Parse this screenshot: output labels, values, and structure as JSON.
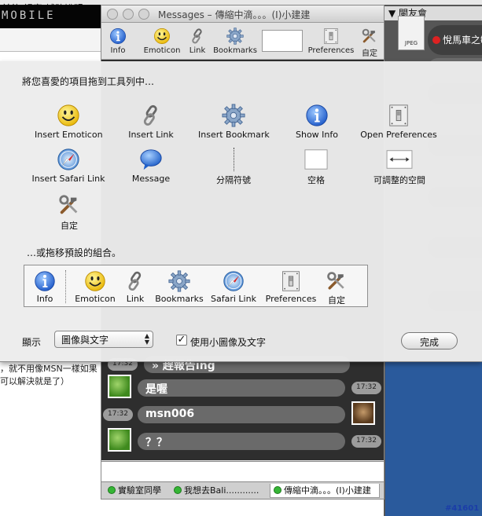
{
  "background": {
    "menubar_text": "前往  視窗  輔助說明",
    "logo_text": "MOBILE",
    "web_text": [
      "，就不用像MSN一樣如果",
      "可以解決就是了）"
    ],
    "jpeg_label": "JPEG",
    "tag": "#41601"
  },
  "buddy_list": {
    "title": "▼ 闌友會",
    "selected_name": "悅馬車之敏"
  },
  "messages_window": {
    "title": "Messages – 傳縮中滴。。。(I)小建建",
    "toolbar": [
      {
        "label": "Info",
        "icon": "info-icon"
      },
      {
        "label": "Emoticon",
        "icon": "smiley-icon"
      },
      {
        "label": "Link",
        "icon": "chain-link-icon"
      },
      {
        "label": "Bookmarks",
        "icon": "gear-icon"
      },
      {
        "label": "Preferences",
        "icon": "light-switch-icon"
      },
      {
        "label": "自定",
        "icon": "tools-icon"
      }
    ],
    "chat": [
      {
        "text": "» 趕報告ing",
        "time": "17:32"
      },
      {
        "text": "是喔",
        "time": "17:32"
      },
      {
        "text": "msn006",
        "time": "17:32"
      },
      {
        "text": "？？",
        "time": "17:32"
      }
    ],
    "tabs": [
      "實驗室同學",
      "我想去Bali............",
      "傳縮中滴。。。(I)小建建"
    ]
  },
  "sheet": {
    "heading_items": "將您喜愛的項目拖到工具列中…",
    "items": [
      {
        "label": "Insert Emoticon",
        "icon": "smiley-icon"
      },
      {
        "label": "Insert Link",
        "icon": "chain-link-icon"
      },
      {
        "label": "Insert Bookmark",
        "icon": "gear-icon"
      },
      {
        "label": "Show Info",
        "icon": "info-icon"
      },
      {
        "label": "Open Preferences",
        "icon": "light-switch-icon"
      },
      {
        "label": "Insert Safari Link",
        "icon": "compass-icon"
      },
      {
        "label": "Message",
        "icon": "speech-bubble-icon"
      },
      {
        "label": "分隔符號",
        "icon": "separator-icon"
      },
      {
        "label": "空格",
        "icon": "space-icon"
      },
      {
        "label": "可調整的空間",
        "icon": "flexible-space-icon"
      },
      {
        "label": "自定",
        "icon": "tools-icon"
      }
    ],
    "heading_default": "…或拖移預設的組合。",
    "default_set": [
      {
        "label": "Info",
        "icon": "info-icon"
      },
      {
        "label": "Emoticon",
        "icon": "smiley-icon"
      },
      {
        "label": "Link",
        "icon": "chain-link-icon"
      },
      {
        "label": "Bookmarks",
        "icon": "gear-icon"
      },
      {
        "label": "Safari Link",
        "icon": "compass-icon"
      },
      {
        "label": "Preferences",
        "icon": "light-switch-icon"
      },
      {
        "label": "自定",
        "icon": "tools-icon"
      }
    ],
    "show_label": "顯示",
    "show_value": "圖像與文字",
    "small_icons_checked": true,
    "small_icons_label": "使用小圖像及文字",
    "done_label": "完成"
  }
}
